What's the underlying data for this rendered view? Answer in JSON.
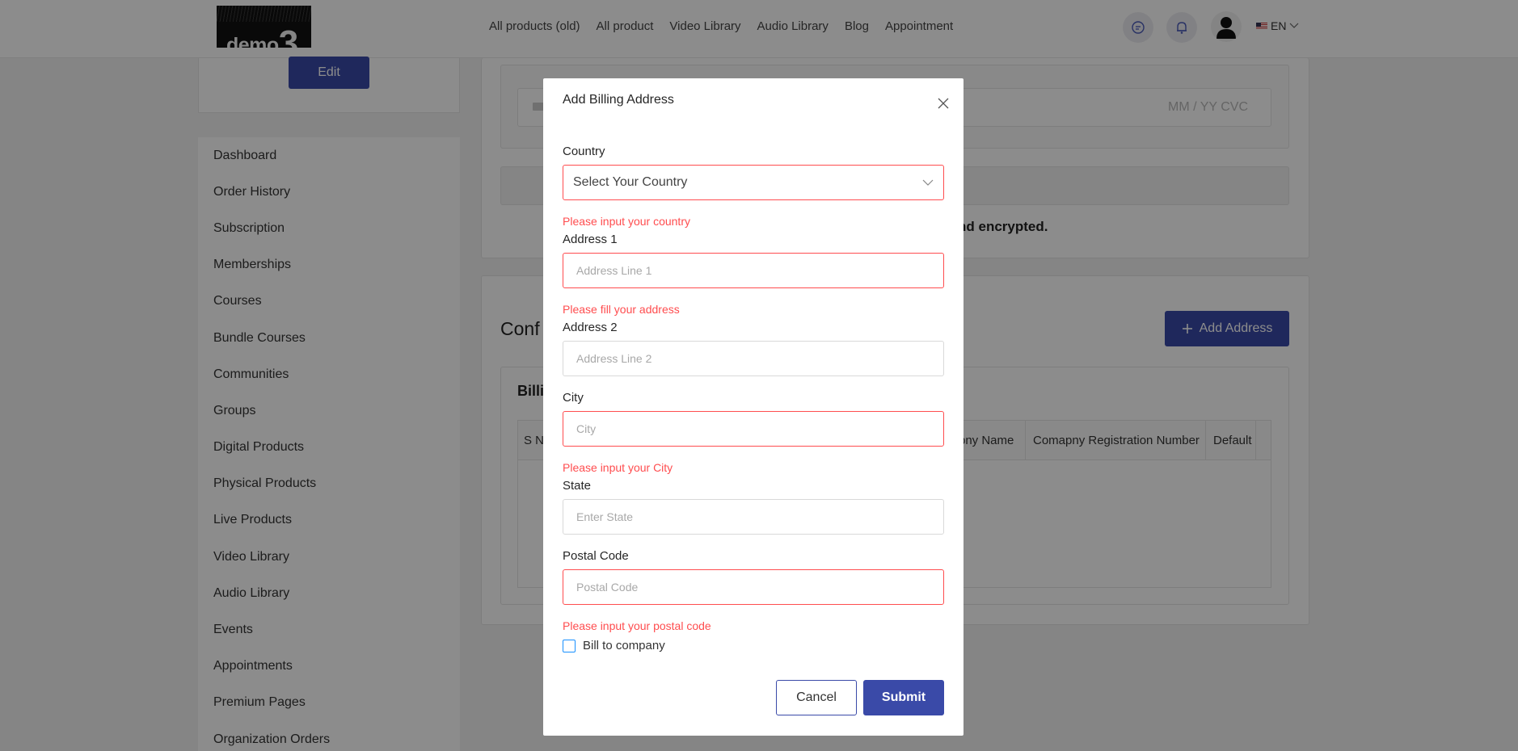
{
  "header": {
    "logo_text": "demo",
    "logo_number": "3",
    "nav": [
      "All products (old)",
      "All product",
      "Video Library",
      "Audio Library",
      "Blog",
      "Appointment"
    ],
    "icons": [
      "chat-icon",
      "bell-icon",
      "user-icon"
    ],
    "language": "EN"
  },
  "profile": {
    "edit_label": "Edit"
  },
  "sidebar": {
    "items": [
      "Dashboard",
      "Order History",
      "Subscription",
      "Memberships",
      "Courses",
      "Bundle Courses",
      "Communities",
      "Groups",
      "Digital Products",
      "Physical Products",
      "Live Products",
      "Video Library",
      "Audio Library",
      "Events",
      "Appointments",
      "Premium Pages",
      "Organization Orders"
    ]
  },
  "main": {
    "card_placeholder": "MM / YY  CVC",
    "secure_note": "nd encrypted.",
    "section_title": "Conf",
    "add_address_label": "Add Address",
    "billing_title": "Billi",
    "table_headers": [
      "S N",
      "pny Name",
      "Comapny Registration Number",
      "Default"
    ]
  },
  "modal": {
    "title": "Add Billing Address",
    "country_label": "Country",
    "country_placeholder": "Select Your Country",
    "country_error": "Please input your country",
    "address1_label": "Address 1",
    "address1_placeholder": "Address Line 1",
    "address1_error": "Please fill your address",
    "address2_label": "Address 2",
    "address2_placeholder": "Address Line 2",
    "city_label": "City",
    "city_placeholder": "City",
    "city_error": "Please input your City",
    "state_label": "State",
    "state_placeholder": "Enter State",
    "postal_label": "Postal Code",
    "postal_placeholder": "Postal Code",
    "postal_error": "Please input your postal code",
    "bill_company_label": "Bill to company",
    "cancel_label": "Cancel",
    "submit_label": "Submit"
  },
  "colors": {
    "primary": "#3a4aa8",
    "error": "#ff4d4f",
    "checkbox": "#1890ff"
  }
}
